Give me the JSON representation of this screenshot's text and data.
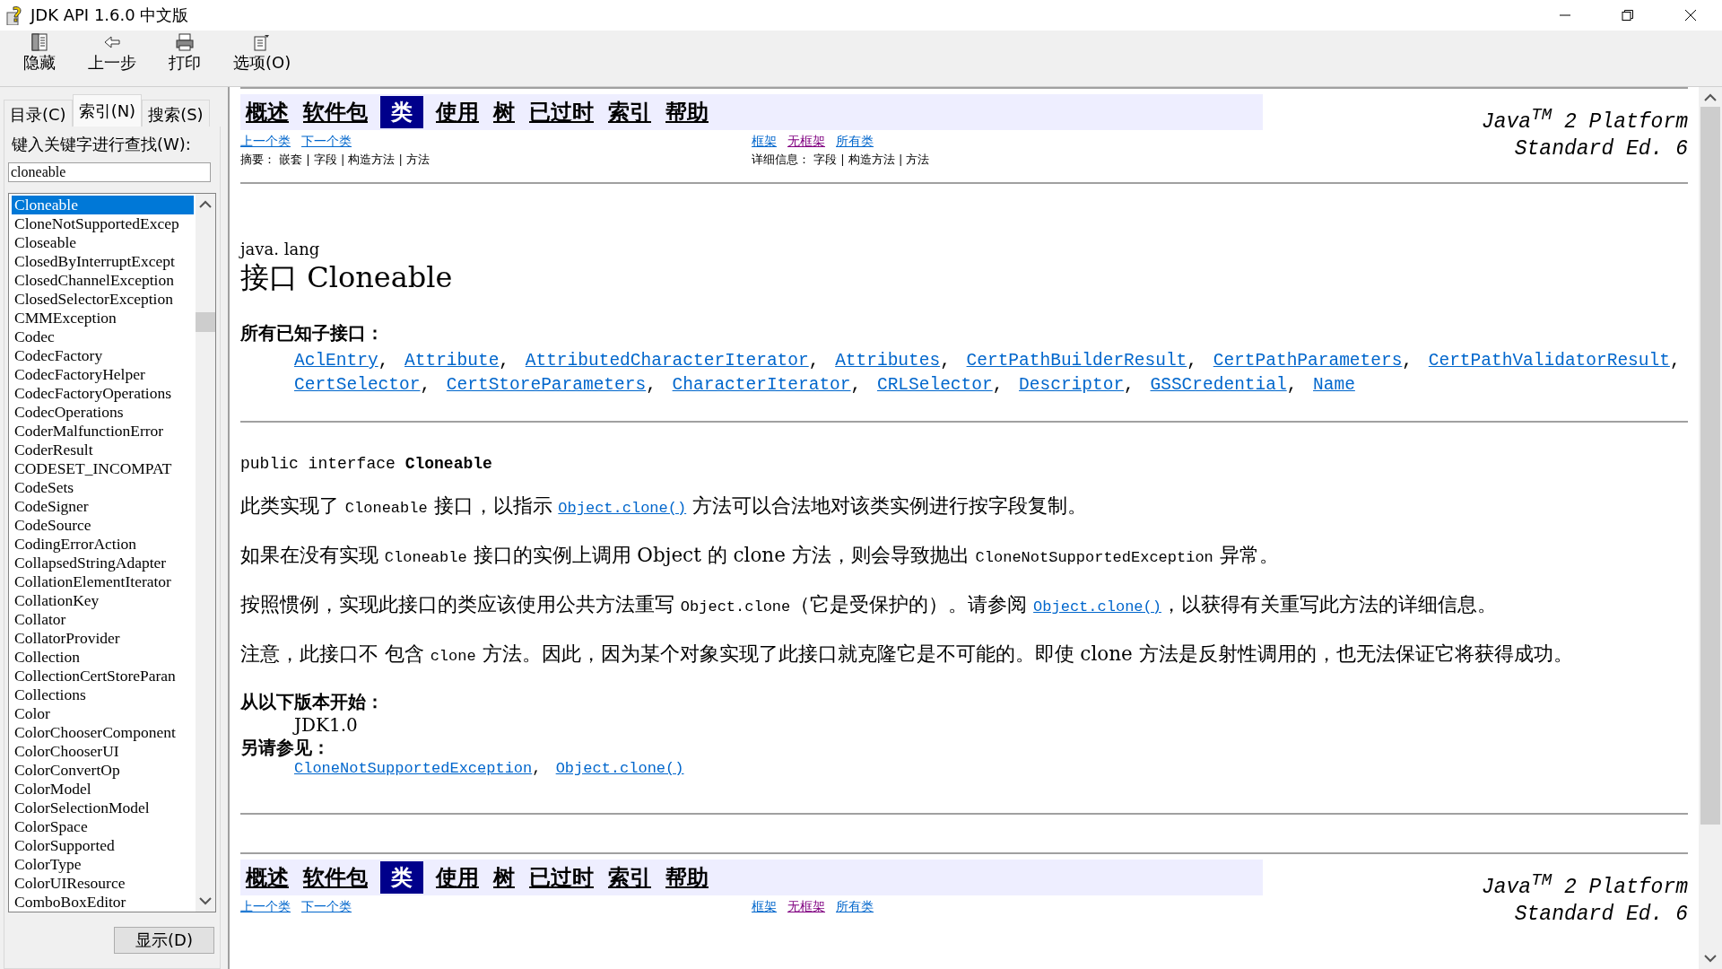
{
  "window": {
    "title": "JDK API 1.6.0 中文版"
  },
  "toolbar": [
    {
      "kind": "hide",
      "label": "隐藏"
    },
    {
      "kind": "back",
      "label": "上一步"
    },
    {
      "kind": "print",
      "label": "打印"
    },
    {
      "kind": "options",
      "label": "选项(O)"
    }
  ],
  "sidebar": {
    "tabs": [
      {
        "label": "目录(C)",
        "selected": false
      },
      {
        "label": "索引(N)",
        "selected": true
      },
      {
        "label": "搜索(S)",
        "selected": false
      }
    ],
    "search_label": "键入关键字进行查找(W):",
    "search_value": "cloneable",
    "items": [
      {
        "label": "Cloneable",
        "selected": true
      },
      {
        "label": "CloneNotSupportedExcep",
        "selected": false
      },
      {
        "label": "Closeable",
        "selected": false
      },
      {
        "label": "ClosedByInterruptExcept",
        "selected": false
      },
      {
        "label": "ClosedChannelException",
        "selected": false
      },
      {
        "label": "ClosedSelectorException",
        "selected": false
      },
      {
        "label": "CMMException",
        "selected": false
      },
      {
        "label": "Codec",
        "selected": false
      },
      {
        "label": "CodecFactory",
        "selected": false
      },
      {
        "label": "CodecFactoryHelper",
        "selected": false
      },
      {
        "label": "CodecFactoryOperations",
        "selected": false
      },
      {
        "label": "CodecOperations",
        "selected": false
      },
      {
        "label": "CoderMalfunctionError",
        "selected": false
      },
      {
        "label": "CoderResult",
        "selected": false
      },
      {
        "label": "CODESET_INCOMPAT",
        "selected": false
      },
      {
        "label": "CodeSets",
        "selected": false
      },
      {
        "label": "CodeSigner",
        "selected": false
      },
      {
        "label": "CodeSource",
        "selected": false
      },
      {
        "label": "CodingErrorAction",
        "selected": false
      },
      {
        "label": "CollapsedStringAdapter",
        "selected": false
      },
      {
        "label": "CollationElementIterator",
        "selected": false
      },
      {
        "label": "CollationKey",
        "selected": false
      },
      {
        "label": "Collator",
        "selected": false
      },
      {
        "label": "CollatorProvider",
        "selected": false
      },
      {
        "label": "Collection",
        "selected": false
      },
      {
        "label": "CollectionCertStoreParan",
        "selected": false
      },
      {
        "label": "Collections",
        "selected": false
      },
      {
        "label": "Color",
        "selected": false
      },
      {
        "label": "ColorChooserComponent",
        "selected": false
      },
      {
        "label": "ColorChooserUI",
        "selected": false
      },
      {
        "label": "ColorConvertOp",
        "selected": false
      },
      {
        "label": "ColorModel",
        "selected": false
      },
      {
        "label": "ColorSelectionModel",
        "selected": false
      },
      {
        "label": "ColorSpace",
        "selected": false
      },
      {
        "label": "ColorSupported",
        "selected": false
      },
      {
        "label": "ColorType",
        "selected": false
      },
      {
        "label": "ColorUIResource",
        "selected": false
      },
      {
        "label": "ComboBoxEditor",
        "selected": false
      }
    ],
    "display_button": "显示(D)"
  },
  "top_nav": {
    "items": [
      {
        "label": "概述",
        "selected": false
      },
      {
        "label": "软件包",
        "selected": false
      },
      {
        "label": "类",
        "selected": true
      },
      {
        "label": "使用",
        "selected": false
      },
      {
        "label": "树",
        "selected": false
      },
      {
        "label": "已过时",
        "selected": false
      },
      {
        "label": "索引",
        "selected": false
      },
      {
        "label": "帮助",
        "selected": false
      }
    ],
    "class_links": [
      {
        "label": "上一个类",
        "visited": false
      },
      {
        "label": "下一个类",
        "visited": false
      }
    ],
    "frame_links": [
      {
        "label": "框架",
        "visited": false
      },
      {
        "label": "无框架",
        "visited": true
      },
      {
        "label": "所有类",
        "visited": false
      }
    ],
    "summary": "摘要： 嵌套 | 字段 | 构造方法 | 方法",
    "detail": "详细信息： 字段 | 构造方法 | 方法",
    "platform": [
      "Java$^{TM}$ 2 Platform",
      "Standard Ed. 6"
    ]
  },
  "package": "java. lang",
  "title": "接口 Cloneable",
  "subinterfaces_heading": "所有已知子接口：",
  "subinterfaces": [
    {
      "name": "AclEntry",
      "separator": ","
    },
    {
      "name": "Attribute",
      "separator": ","
    },
    {
      "name": "AttributedCharacterIterator",
      "separator": ","
    },
    {
      "name": "Attributes",
      "separator": ","
    },
    {
      "name": "CertPathBuilderResult",
      "separator": ","
    },
    {
      "name": "CertPathParameters",
      "separator": ","
    },
    {
      "name": "CertPathValidatorResult",
      "separator": ","
    },
    {
      "name": "CertSelector",
      "separator": ","
    },
    {
      "name": "CertStoreParameters",
      "separator": ","
    },
    {
      "name": "CharacterIterator",
      "separator": ","
    },
    {
      "name": "CRLSelector",
      "separator": ","
    },
    {
      "name": "Descriptor",
      "separator": ","
    },
    {
      "name": "GSSCredential",
      "separator": ","
    },
    {
      "name": "Name"
    }
  ],
  "declaration": "public interface **Cloneable**",
  "paragraphs": [
    [
      {
        "kind": "text",
        "text": "此类实现了 "
      },
      {
        "kind": "code",
        "text": "Cloneable"
      },
      {
        "kind": "text",
        "text": " 接口，以指示 "
      },
      {
        "kind": "link",
        "text": "Object.clone()"
      },
      {
        "kind": "text",
        "text": " 方法可以合法地对该类实例进行按字段复制。"
      }
    ],
    [
      {
        "kind": "text",
        "text": "如果在没有实现 "
      },
      {
        "kind": "code",
        "text": "Cloneable"
      },
      {
        "kind": "text",
        "text": " 接口的实例上调用 Object 的 clone 方法，则会导致抛出 "
      },
      {
        "kind": "code",
        "text": "CloneNotSupportedException"
      },
      {
        "kind": "text",
        "text": " 异常。"
      }
    ],
    [
      {
        "kind": "text",
        "text": "按照惯例，实现此接口的类应该使用公共方法重写 "
      },
      {
        "kind": "code",
        "text": "Object.clone"
      },
      {
        "kind": "text",
        "text": "（它是受保护的）。请参阅 "
      },
      {
        "kind": "link",
        "text": "Object.clone()"
      },
      {
        "kind": "text",
        "text": "，以获得有关重写此方法的详细信息。"
      }
    ],
    [
      {
        "kind": "text",
        "text": "注意，此接口不 包含 "
      },
      {
        "kind": "code",
        "text": "clone"
      },
      {
        "kind": "text",
        "text": " 方法。因此，因为某个对象实现了此接口就克隆它是不可能的。即使 clone 方法是反射性调用的，也无法保证它将获得成功。"
      }
    ]
  ],
  "since_heading": "从以下版本开始：",
  "since": "JDK1.0",
  "see_also_heading": "另请参见：",
  "see_also": [
    {
      "name": "CloneNotSupportedException",
      "separator": ","
    },
    {
      "name": "Object.clone()"
    }
  ],
  "bottom_nav": {
    "items": [
      {
        "label": "概述",
        "selected": false
      },
      {
        "label": "软件包",
        "selected": false
      },
      {
        "label": "类",
        "selected": true
      },
      {
        "label": "使用",
        "selected": false
      },
      {
        "label": "树",
        "selected": false
      },
      {
        "label": "已过时",
        "selected": false
      },
      {
        "label": "索引",
        "selected": false
      },
      {
        "label": "帮助",
        "selected": false
      }
    ],
    "class_links": [
      {
        "label": "上一个类",
        "visited": false
      },
      {
        "label": "下一个类",
        "visited": false
      }
    ],
    "frame_links": [
      {
        "label": "框架",
        "visited": false
      },
      {
        "label": "无框架",
        "visited": true
      },
      {
        "label": "所有类",
        "visited": false
      }
    ],
    "platform": [
      "Java$^{TM}$ 2 Platform",
      "Standard Ed. 6"
    ]
  }
}
